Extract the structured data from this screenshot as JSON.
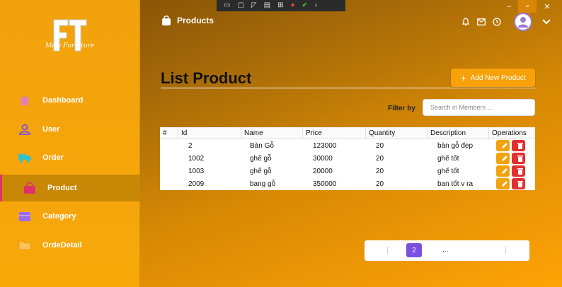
{
  "sidebar": {
    "logo_text": "Mew Furniture",
    "items": [
      {
        "label": "Dashboard",
        "icon": "home-icon"
      },
      {
        "label": "User",
        "icon": "user-icon"
      },
      {
        "label": "Order",
        "icon": "truck-icon"
      },
      {
        "label": "Product",
        "icon": "bag-icon"
      },
      {
        "label": "Category",
        "icon": "box-icon"
      },
      {
        "label": "OrdeDetail",
        "icon": "folder-icon"
      }
    ],
    "active_index": 3
  },
  "header": {
    "title": "Products"
  },
  "main": {
    "title": "List Product",
    "add_button": "Add New Product",
    "filter_label": "Filter by",
    "search_placeholder": "Search in Members ..."
  },
  "table": {
    "columns": [
      "#",
      "Id",
      "Name",
      "Price",
      "Quantity",
      "Description",
      "Operations"
    ],
    "rows": [
      {
        "id": "2",
        "name": "Bàn Gỗ",
        "price": "123000",
        "quantity": "20",
        "description": "bàn gỗ đẹp"
      },
      {
        "id": "1002",
        "name": "ghế gỗ",
        "price": "30000",
        "quantity": "20",
        "description": "ghế tốt"
      },
      {
        "id": "1003",
        "name": "ghế gỗ",
        "price": "20000",
        "quantity": "20",
        "description": "ghế tốt"
      },
      {
        "id": "2009",
        "name": "bang gỗ",
        "price": "350000",
        "quantity": "20",
        "description": "ban tốt v ra"
      }
    ]
  },
  "pagination": {
    "current_page": "2",
    "ellipsis": "..."
  },
  "colors": {
    "accent": "#f2a20c",
    "delete": "#e03030",
    "active_page": "#7b4fe0"
  }
}
